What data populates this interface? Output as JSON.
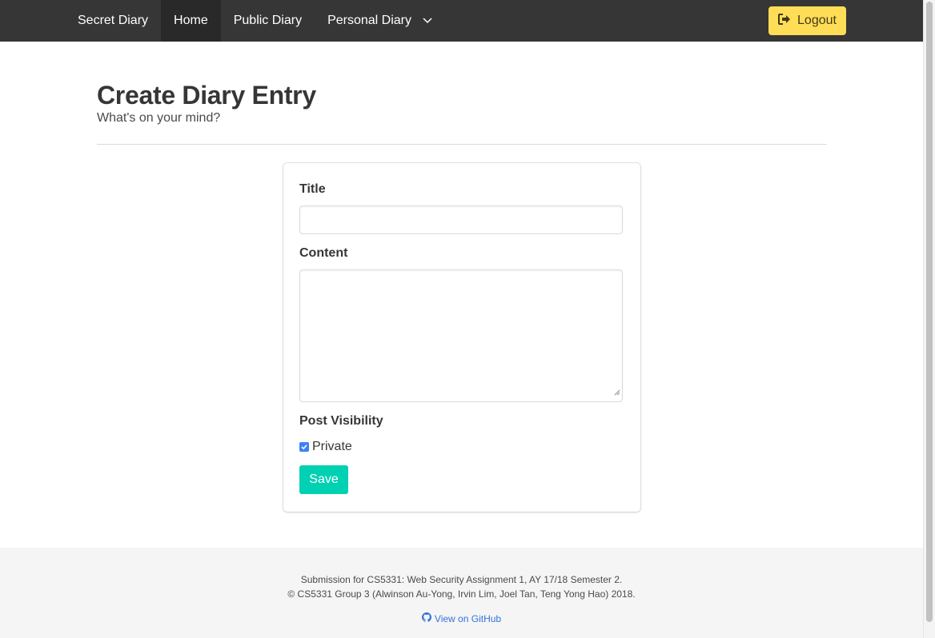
{
  "navbar": {
    "brand": "Secret Diary",
    "items": [
      {
        "label": "Home",
        "active": true
      },
      {
        "label": "Public Diary",
        "active": false
      }
    ],
    "dropdown_label": "Personal Diary",
    "logout_label": "Logout",
    "logout_color": "#ffdd57",
    "background": "#363636"
  },
  "header": {
    "title": "Create Diary Entry",
    "subtitle": "What's on your mind?"
  },
  "form": {
    "title_label": "Title",
    "title_value": "",
    "content_label": "Content",
    "content_value": "",
    "visibility_label": "Post Visibility",
    "private_label": "Private",
    "private_checked": true,
    "save_label": "Save",
    "save_color": "#00d1b2"
  },
  "footer": {
    "line1": "Submission for CS5331: Web Security Assignment 1, AY 17/18 Semester 2.",
    "line2": "© CS5331 Group 3 (Alwinson Au-Yong, Irvin Lim, Joel Tan, Teng Yong Hao) 2018.",
    "github_label": "View on GitHub",
    "github_icon": "github-icon"
  }
}
